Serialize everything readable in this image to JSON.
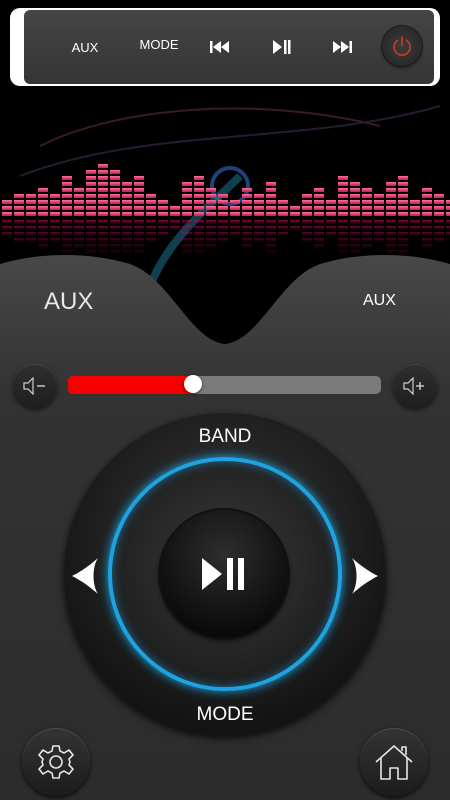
{
  "toolbar": {
    "aux_label": "AUX",
    "mode_label": "MODE"
  },
  "source": {
    "left_label": "AUX",
    "right_label": "AUX"
  },
  "volume": {
    "level": 0.4
  },
  "dial": {
    "band_label": "BAND",
    "mode_label": "MODE"
  },
  "colors": {
    "accent_blue": "#1ea2e0",
    "volume_fill": "#f40000",
    "power_icon": "#c0392b"
  },
  "icons": [
    "previous-track-icon",
    "play-pause-icon",
    "next-track-icon",
    "power-icon",
    "volume-down-icon",
    "volume-up-icon",
    "chevron-left-icon",
    "chevron-right-icon",
    "gear-icon",
    "home-icon"
  ]
}
